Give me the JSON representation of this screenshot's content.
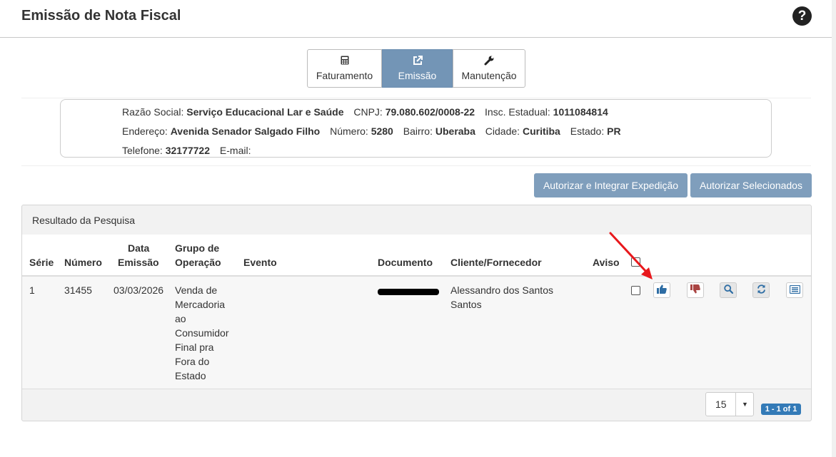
{
  "header": {
    "title": "Emissão de Nota Fiscal",
    "help_glyph": "?"
  },
  "tabs": [
    {
      "label": "Faturamento",
      "icon": "calculator-icon",
      "active": false
    },
    {
      "label": "Emissão",
      "icon": "external-link-icon",
      "active": true
    },
    {
      "label": "Manutenção",
      "icon": "wrench-icon",
      "active": false
    }
  ],
  "company": {
    "razao_label": "Razão Social:",
    "razao": "Serviço Educacional Lar e Saúde",
    "cnpj_label": "CNPJ:",
    "cnpj": "79.080.602/0008-22",
    "ie_label": "Insc. Estadual:",
    "ie": "1011084814",
    "endereco_label": "Endereço:",
    "endereco": "Avenida Senador Salgado Filho",
    "numero_label": "Número:",
    "numero": "5280",
    "bairro_label": "Bairro:",
    "bairro": "Uberaba",
    "cidade_label": "Cidade:",
    "cidade": "Curitiba",
    "estado_label": "Estado:",
    "estado": "PR",
    "telefone_label": "Telefone:",
    "telefone": "32177722",
    "email_label": "E-mail:",
    "email": ""
  },
  "buttons": {
    "autorizar_integrar": "Autorizar e Integrar Expedição",
    "autorizar_selecionados": "Autorizar Selecionados"
  },
  "panel": {
    "title": "Resultado da Pesquisa"
  },
  "table": {
    "headers": {
      "serie": "Série",
      "numero": "Número",
      "data1": "Data",
      "data2": "Emissão",
      "grupo1": "Grupo de",
      "grupo2": "Operação",
      "evento": "Evento",
      "documento": "Documento",
      "cliente": "Cliente/Fornecedor",
      "aviso": "Aviso"
    },
    "rows": [
      {
        "serie": "1",
        "numero": "31455",
        "data": "03/03/2026",
        "grupo_lines": [
          "Venda de",
          "Mercadoria",
          "ao",
          "Consumidor",
          "Final pra",
          "Fora do",
          "Estado"
        ],
        "evento": "",
        "documento": "",
        "cliente_lines": [
          "Alessandro dos Santos",
          "Santos"
        ],
        "aviso": ""
      }
    ],
    "actions": [
      "thumbs-up-icon",
      "thumbs-down-icon",
      "search-icon",
      "refresh-icon",
      "list-icon"
    ]
  },
  "pagination": {
    "page_size": "15",
    "range": "1 - 1 of 1"
  },
  "colors": {
    "accent": "#7395b6",
    "button": "#7f9ebc",
    "badge": "#337ab7",
    "thumbs_up": "#2e6da4",
    "thumbs_down": "#a94442",
    "annotation_arrow": "#e8181c"
  }
}
